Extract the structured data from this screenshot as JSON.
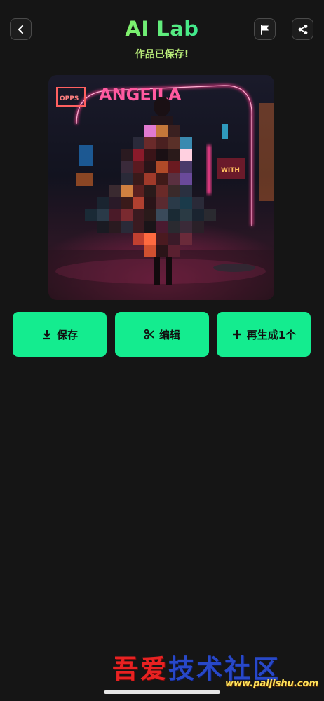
{
  "header": {
    "title": "AI Lab",
    "subtitle": "作品已保存!",
    "back_icon": "chevron-left-icon",
    "flag_icon": "flag-icon",
    "share_icon": "share-icon"
  },
  "image": {
    "sign_text": "ANGEILA",
    "left_sign_text": "OPPS",
    "right_sign_text": "WITH"
  },
  "actions": {
    "save_label": "保存",
    "edit_label": "编辑",
    "regenerate_label": "再生成1个"
  },
  "watermark": {
    "title_red": "吾爱",
    "title_blue_1": "技术社",
    "title_blue_2": "区",
    "url": "www.paijishu.com"
  },
  "colors": {
    "background": "#151515",
    "accent": "#14ec8f",
    "subtitle": "#b8ec79"
  }
}
